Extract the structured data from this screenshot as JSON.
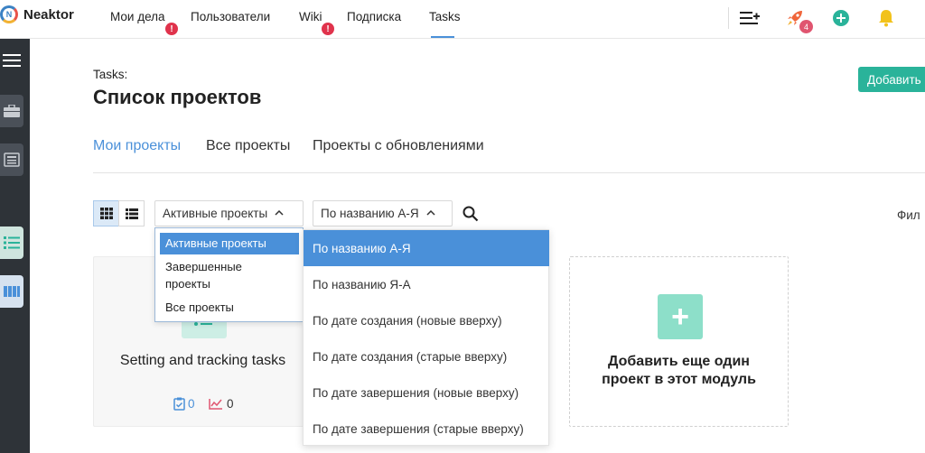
{
  "app": {
    "name": "Neaktor",
    "logo_letter": "N"
  },
  "nav": {
    "items": [
      {
        "label": "Мои дела",
        "alert": "!"
      },
      {
        "label": "Пользователи"
      },
      {
        "label": "Wiki",
        "alert": "!"
      },
      {
        "label": "Подписка"
      },
      {
        "label": "Tasks",
        "active": true
      }
    ]
  },
  "toolbar": {
    "icons": [
      "add-list-icon",
      "rocket-icon",
      "plus-circle-icon",
      "bell-icon"
    ],
    "rocket_badge": "4"
  },
  "sidebar": {
    "icons": [
      "menu-icon",
      "briefcase-icon",
      "news-icon",
      "task-list-icon",
      "board-icon"
    ]
  },
  "page": {
    "breadcrumb": "Tasks:",
    "title": "Список проектов",
    "add_button": "Добавить"
  },
  "tabs": [
    "Мои проекты",
    "Все проекты",
    "Проекты с обновлениями"
  ],
  "filters": {
    "status_select": "Активные проекты",
    "sort_select": "По названию А-Я",
    "filter_label": "Фил"
  },
  "status_options": [
    "Активные проекты",
    "Завершенные проекты",
    "Все проекты"
  ],
  "sort_options": [
    "По названию А-Я",
    "По названию Я-А",
    "По дате создания (новые вверху)",
    "По дате создания (старые вверху)",
    "По дате завершения (новые вверху)",
    "По дате завершения (старые вверху)"
  ],
  "cards": [
    {
      "title": "Setting and tracking tasks",
      "tasks_count": "0",
      "activity_count": "0"
    }
  ],
  "add_card": {
    "line1": "Добавить еще один",
    "line2": "проект в этот модуль"
  },
  "colors": {
    "accent": "#4a90d9",
    "add_button": "#2ab39a",
    "alert": "#e0334c",
    "sidebar": "#2e3338"
  }
}
